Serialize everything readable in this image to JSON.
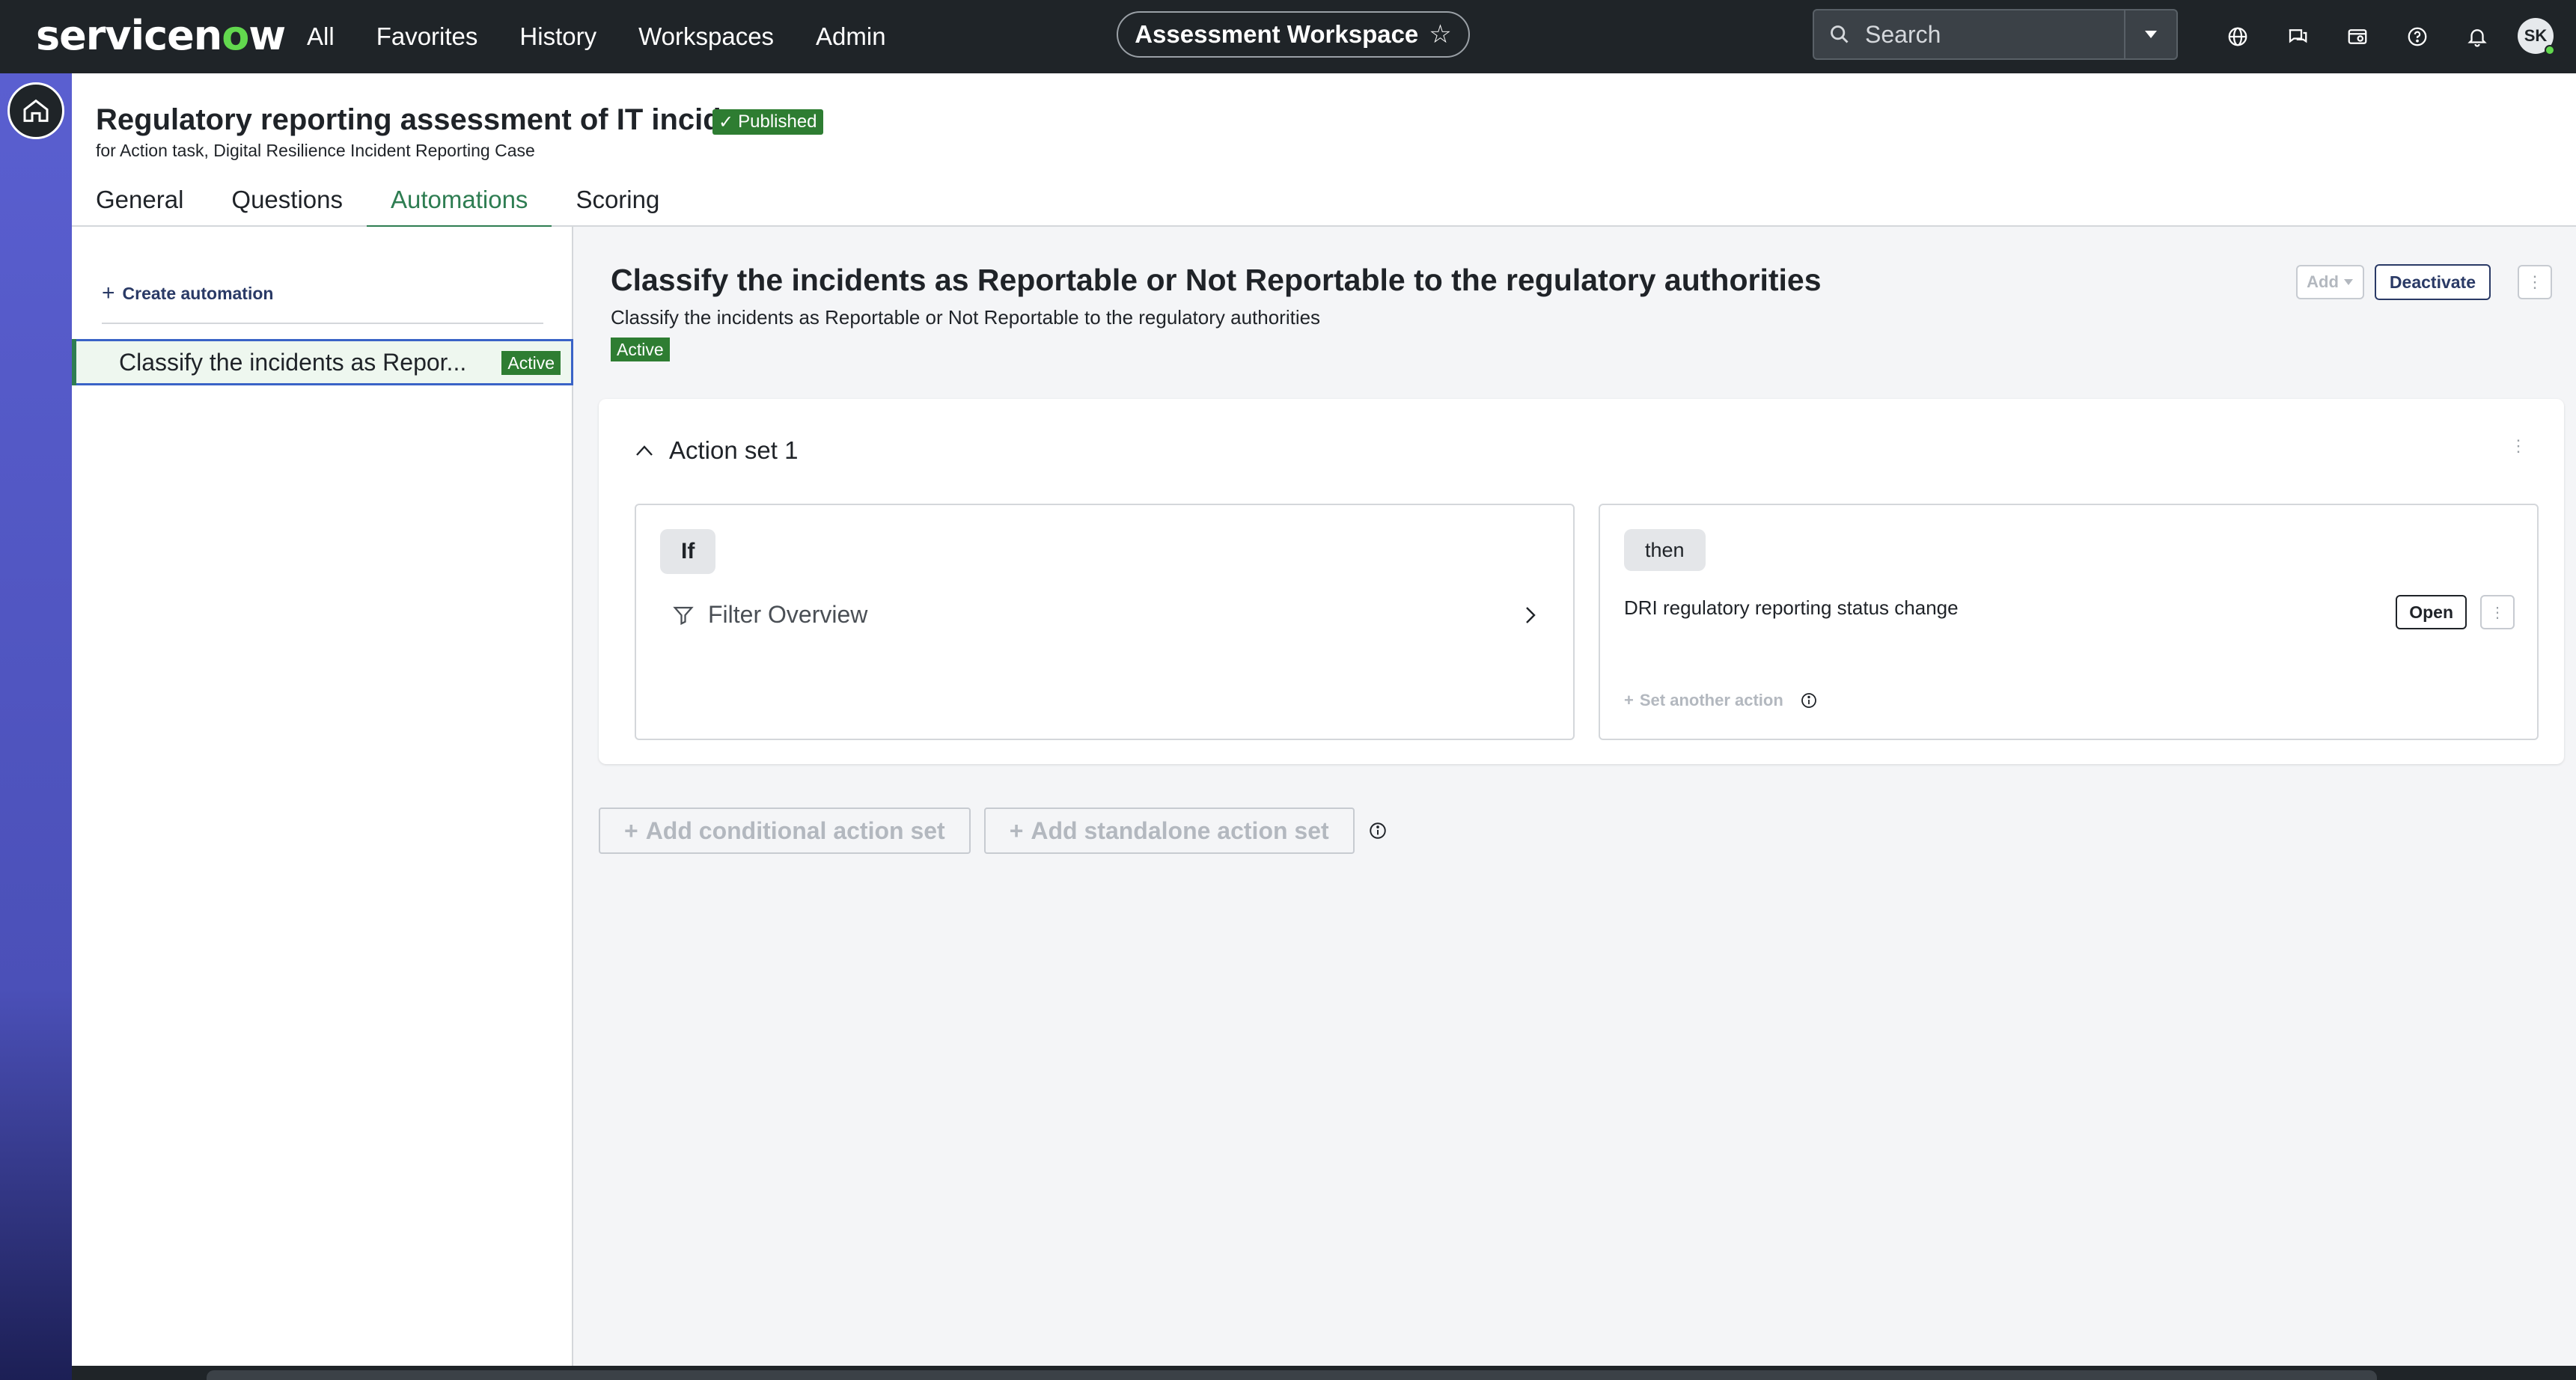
{
  "topnav": {
    "logo": "servicenow",
    "items": [
      "All",
      "Favorites",
      "History",
      "Workspaces",
      "Admin"
    ],
    "workspace": "Assessment Workspace",
    "search_placeholder": "Search",
    "avatar_initials": "SK"
  },
  "page": {
    "title": "Regulatory reporting assessment of IT incidents",
    "status": "Published",
    "subtitle": "for Action task, Digital Resilience Incident Reporting Case",
    "tabs": [
      "General",
      "Questions",
      "Automations",
      "Scoring"
    ],
    "active_tab": "Automations"
  },
  "sidebar": {
    "create_label": "Create automation",
    "items": [
      {
        "label": "Classify the incidents as Repor...",
        "status": "Active"
      }
    ]
  },
  "automation": {
    "title": "Classify the incidents as Reportable or Not Reportable to the regulatory authorities",
    "description": "Classify the incidents as Reportable or Not Reportable to the regulatory authorities",
    "status": "Active",
    "buttons": {
      "add": "Add",
      "deactivate": "Deactivate"
    },
    "action_set": {
      "title": "Action set 1",
      "if_label": "If",
      "filter_label": "Filter Overview",
      "then_label": "then",
      "action_name": "DRI regulatory reporting status change",
      "open_label": "Open",
      "set_another_label": "Set another action"
    },
    "bottom_buttons": {
      "conditional": "Add conditional action set",
      "standalone": "Add standalone action set"
    }
  },
  "colors": {
    "accent_green": "#2e7d52",
    "badge_green": "#2e7d32",
    "nav_bg": "#1f2428",
    "rail": "#5a5fd0"
  }
}
